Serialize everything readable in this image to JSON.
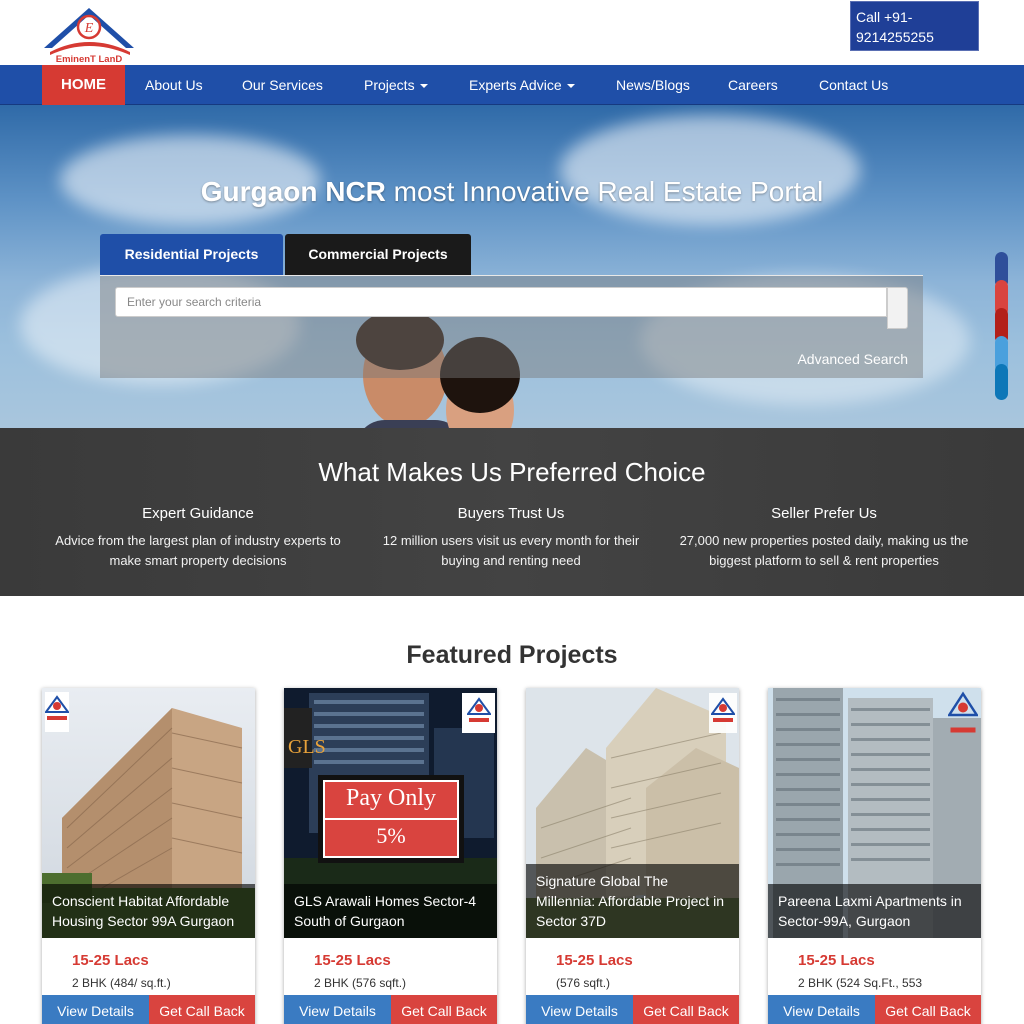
{
  "header": {
    "logo_text": "EminenT LanD",
    "call": "Call +91-9214255255"
  },
  "nav": {
    "items": [
      {
        "label": "HOME",
        "dropdown": false
      },
      {
        "label": "About Us",
        "dropdown": false
      },
      {
        "label": "Our Services",
        "dropdown": false
      },
      {
        "label": "Projects",
        "dropdown": true
      },
      {
        "label": "Experts Advice",
        "dropdown": true
      },
      {
        "label": "News/Blogs",
        "dropdown": false
      },
      {
        "label": "Careers",
        "dropdown": false
      },
      {
        "label": "Contact Us",
        "dropdown": false
      }
    ]
  },
  "hero": {
    "title_bold": "Gurgaon NCR",
    "title_rest": " most Innovative Real Estate Portal",
    "tabs": [
      "Residential Projects",
      "Commercial Projects"
    ],
    "search_placeholder": "Enter your search criteria",
    "advanced_search": "Advanced Search"
  },
  "social_colors": [
    "#2f4f9a",
    "#d9443f",
    "#b3201a",
    "#4aa0dd",
    "#0d77b8"
  ],
  "preferred": {
    "title": "What Makes Us Preferred Choice",
    "columns": [
      {
        "heading": "Expert Guidance",
        "text": "Advice from the largest plan of industry experts to make smart property decisions"
      },
      {
        "heading": "Buyers Trust Us",
        "text": "12 million users visit us every month for their buying and renting need"
      },
      {
        "heading": "Seller Prefer Us",
        "text": "27,000 new properties posted daily, making us the biggest platform to sell & rent properties"
      }
    ]
  },
  "featured": {
    "title": "Featured Projects",
    "cards": [
      {
        "name": "Conscient Habitat Affordable Housing Sector 99A Gurgaon",
        "price": "15-25 Lacs",
        "config": "2 BHK (484/ sq.ft.)",
        "view": "View Details",
        "call": "Get Call Back"
      },
      {
        "name": "GLS Arawali Homes Sector-4 South of Gurgaon",
        "price": "15-25 Lacs",
        "config": "2 BHK (576 sqft.)",
        "view": "View Details",
        "call": "Get Call Back",
        "ad_brand": "GLS",
        "ad_line1": "Pay Only",
        "ad_line2": "5%"
      },
      {
        "name": "Signature Global The Millennia: Affordable Project in Sector 37D",
        "price": "15-25 Lacs",
        "config": "(576 sqft.)",
        "view": "View Details",
        "call": "Get Call Back"
      },
      {
        "name": "Pareena Laxmi Apartments in Sector-99A, Gurgaon",
        "price": "15-25 Lacs",
        "config": "2 BHK (524 Sq.Ft., 553",
        "view": "View Details",
        "call": "Get Call Back"
      }
    ]
  },
  "colors": {
    "nav_blue": "#1f4fa8",
    "accent_red": "#d63a33",
    "button_blue": "#3a7bc2"
  }
}
